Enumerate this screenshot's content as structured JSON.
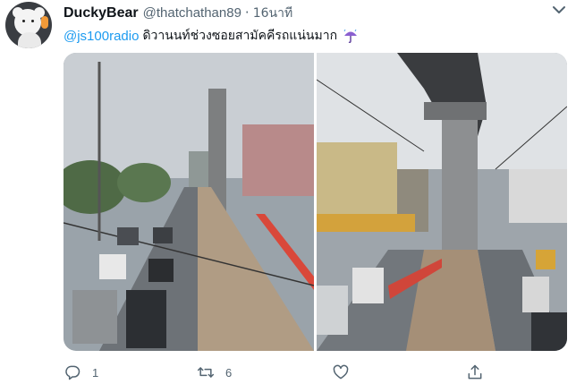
{
  "tweet": {
    "display_name": "DuckyBear",
    "handle": "@thatchathan89",
    "separator": "·",
    "time": "16นาที",
    "mention": "@js100radio",
    "text": "ดิวานนท์ช่วงซอยสามัคคีรถแน่นมาก",
    "emoji_icon": "umbrella-rain-icon"
  },
  "actions": {
    "reply_count": "1",
    "retweet_count": "6",
    "like_count": "",
    "icons": [
      "reply-icon",
      "retweet-icon",
      "like-icon",
      "share-icon"
    ]
  },
  "colors": {
    "link": "#1d9bf0",
    "muted": "#536471",
    "text": "#0f1419"
  }
}
